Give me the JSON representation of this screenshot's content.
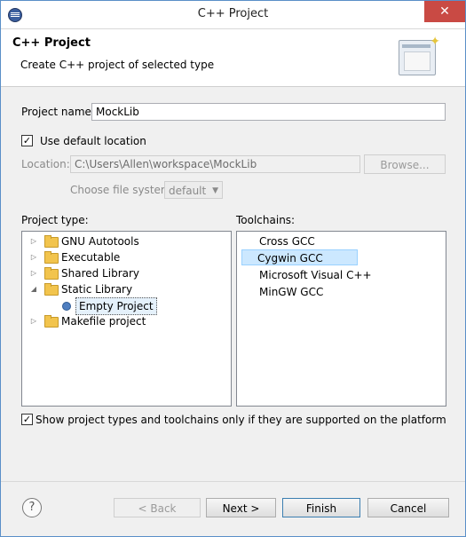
{
  "window": {
    "title": "C++ Project",
    "close_glyph": "✕"
  },
  "banner": {
    "title": "C++ Project",
    "description": "Create C++ project of selected type"
  },
  "project_name": {
    "label": "Project name:",
    "value": "MockLib"
  },
  "location": {
    "use_default_label": "Use default location",
    "use_default_checked": true,
    "label": "Location:",
    "value": "C:\\Users\\Allen\\workspace\\MockLib",
    "browse_label": "Browse...",
    "file_system_label": "Choose file system:",
    "file_system_value": "default"
  },
  "project_type": {
    "label": "Project type:",
    "items": [
      {
        "label": "GNU Autotools",
        "expanded": false,
        "level": 0,
        "icon": "folder-icon"
      },
      {
        "label": "Executable",
        "expanded": false,
        "level": 0,
        "icon": "folder-icon"
      },
      {
        "label": "Shared Library",
        "expanded": false,
        "level": 0,
        "icon": "folder-icon"
      },
      {
        "label": "Static Library",
        "expanded": true,
        "level": 0,
        "icon": "folder-icon"
      },
      {
        "label": "Empty Project",
        "level": 1,
        "icon": "bullet-icon",
        "selected": true
      },
      {
        "label": "Makefile project",
        "expanded": false,
        "level": 0,
        "icon": "folder-icon"
      }
    ]
  },
  "toolchains": {
    "label": "Toolchains:",
    "items": [
      {
        "label": "Cross GCC",
        "selected": false
      },
      {
        "label": "Cygwin GCC",
        "selected": true
      },
      {
        "label": "Microsoft Visual C++",
        "selected": false
      },
      {
        "label": "MinGW GCC",
        "selected": false
      }
    ]
  },
  "filter": {
    "label": "Show project types and toolchains only if they are supported on the platform",
    "checked": true
  },
  "buttons": {
    "help": "?",
    "back": "< Back",
    "next": "Next >",
    "finish": "Finish",
    "cancel": "Cancel"
  },
  "colors": {
    "close_red": "#c94a44",
    "selection_blue": "#cce8ff",
    "default_button_border": "#3c7fb1"
  }
}
